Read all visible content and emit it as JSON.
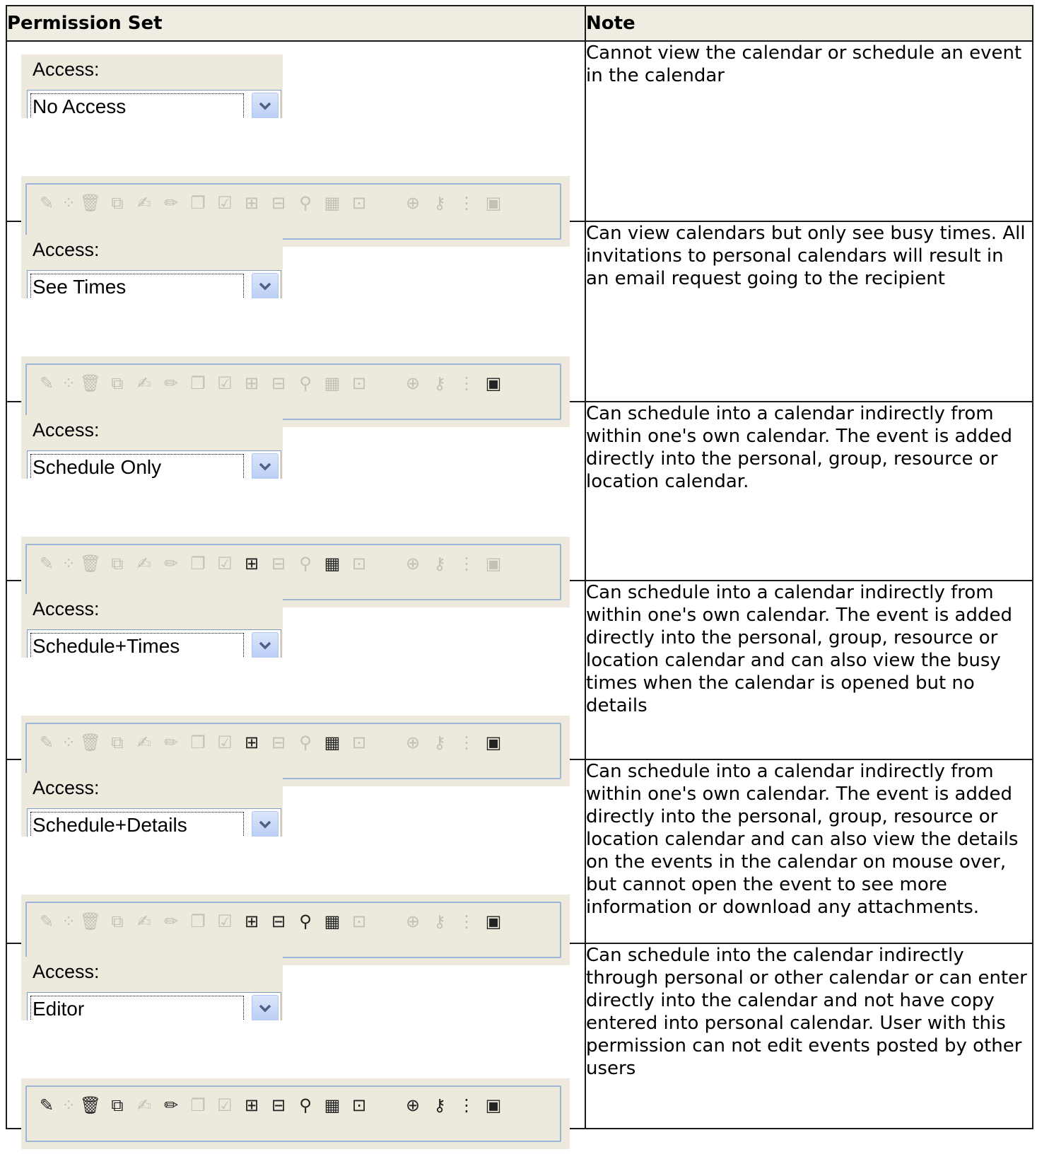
{
  "table": {
    "headers": {
      "permission_set": "Permission Set",
      "note": "Note"
    },
    "rows": [
      {
        "access_label": "Access:",
        "access_value": "No Access",
        "note": "Cannot view the calendar or schedule an event in the calendar",
        "toolbar_enabled": []
      },
      {
        "access_label": "Access:",
        "access_value": "See Times",
        "note": "Can view calendars but only see busy times. All invitations to personal calendars will result in an email request going to the recipient",
        "toolbar_enabled": [
          "publish-calendar-icon"
        ]
      },
      {
        "access_label": "Access:",
        "access_value": "Schedule Only",
        "note": "Can schedule into a calendar indirectly from within one's own calendar.  The event is added directly into the personal, group, resource or location calendar.",
        "toolbar_enabled": [
          "delete-info-icon",
          "schedule-info-icon"
        ]
      },
      {
        "access_label": "Access:",
        "access_value": "Schedule+Times",
        "note": "Can schedule into a calendar indirectly from within one's own calendar.  The event is added directly into the personal, group, resource or location calendar and can also view the busy times when the calendar is opened but no details",
        "toolbar_enabled": [
          "delete-info-icon",
          "schedule-info-icon",
          "publish-calendar-icon"
        ]
      },
      {
        "access_label": "Access:",
        "access_value": "Schedule+Details",
        "note": "Can schedule into a calendar indirectly from within one's own calendar.  The event is added directly into the personal, group, resource or location calendar and can also view the details on the events in the calendar on mouse over, but cannot open the event to see more information or download any attachments.",
        "toolbar_enabled": [
          "delete-info-icon",
          "details-calendar-icon",
          "search-icon",
          "schedule-info-icon",
          "publish-calendar-icon"
        ]
      },
      {
        "access_label": "Access:",
        "access_value": "Editor",
        "note": "Can schedule into the calendar indirectly through personal or other calendar or can enter directly into the calendar and not have copy entered into personal calendar.  User with this permission can not edit events posted by other users",
        "toolbar_enabled": [
          "edit-key-icon",
          "delete-icon",
          "copy-event-icon",
          "pencil-icon",
          "delete-info-icon",
          "details-calendar-icon",
          "search-icon",
          "schedule-info-icon",
          "share-calendar-icon",
          "user-permission-icon",
          "users-key-icon",
          "tree-icon",
          "publish-calendar-icon"
        ]
      }
    ]
  },
  "toolbar_icons": [
    {
      "name": "edit-key-icon",
      "glyph": "✎"
    },
    {
      "name": "dot-icon",
      "glyph": "⁘",
      "small": true
    },
    {
      "name": "delete-icon",
      "glyph": "🗑"
    },
    {
      "name": "copy-event-icon",
      "glyph": "⧉"
    },
    {
      "name": "sign-icon",
      "glyph": "✍"
    },
    {
      "name": "pencil-icon",
      "glyph": "✏"
    },
    {
      "name": "duplicate-icon",
      "glyph": "❐"
    },
    {
      "name": "checkbox-icon",
      "glyph": "☑"
    },
    {
      "name": "delete-info-icon",
      "glyph": "⊞"
    },
    {
      "name": "details-calendar-icon",
      "glyph": "⊟"
    },
    {
      "name": "search-icon",
      "glyph": "⚲"
    },
    {
      "name": "schedule-info-icon",
      "glyph": "▦"
    },
    {
      "name": "share-calendar-icon",
      "glyph": "⊡"
    },
    {
      "name": "user-permission-icon",
      "glyph": "⊕",
      "gap": true
    },
    {
      "name": "users-key-icon",
      "glyph": "⚷"
    },
    {
      "name": "tree-icon",
      "glyph": "⋮"
    },
    {
      "name": "publish-calendar-icon",
      "glyph": "▣"
    }
  ],
  "colors": {
    "header_bg": "#efece2",
    "panel_bg": "#ede9dd",
    "border": "#1a1a1a",
    "enabled_icon": "#222222",
    "disabled_icon": "#c4c0b4"
  }
}
